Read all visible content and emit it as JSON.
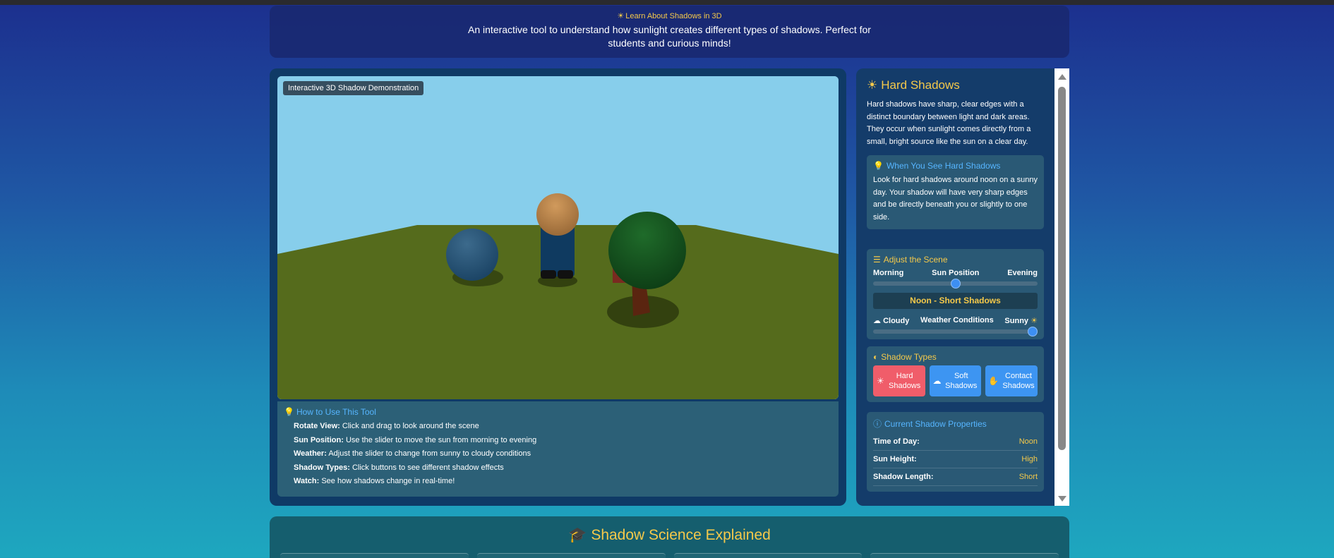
{
  "header": {
    "kicker": "Learn About Shadows in 3D",
    "description": "An interactive tool to understand how sunlight creates different types of shadows. Perfect for students and curious minds!"
  },
  "viewport": {
    "badge": "Interactive 3D Shadow Demonstration"
  },
  "howto": {
    "title": "How to Use This Tool",
    "items": [
      {
        "label": "Rotate View:",
        "text": "Click and drag to look around the scene"
      },
      {
        "label": "Sun Position:",
        "text": "Use the slider to move the sun from morning to evening"
      },
      {
        "label": "Weather:",
        "text": "Adjust the slider to change from sunny to cloudy conditions"
      },
      {
        "label": "Shadow Types:",
        "text": "Click buttons to see different shadow effects"
      },
      {
        "label": "Watch:",
        "text": "See how shadows change in real-time!"
      }
    ]
  },
  "side": {
    "title": "Hard Shadows",
    "description": "Hard shadows have sharp, clear edges with a distinct boundary between light and dark areas. They occur when sunlight comes directly from a small, bright source like the sun on a clear day.",
    "when": {
      "title": "When You See Hard Shadows",
      "text": "Look for hard shadows around noon on a sunny day. Your shadow will have very sharp edges and be directly beneath you or slightly to one side."
    },
    "adjust": {
      "title": "Adjust the Scene",
      "sun_left": "Morning",
      "sun_center": "Sun Position",
      "sun_right": "Evening",
      "sun_value": 0.5,
      "status": "Noon - Short Shadows",
      "wx_left": "Cloudy",
      "wx_center": "Weather Conditions",
      "wx_right": "Sunny",
      "wx_value": 1.0
    },
    "types": {
      "title": "Shadow Types",
      "hard": "Hard Shadows",
      "soft": "Soft Shadows",
      "contact": "Contact Shadows"
    },
    "props": {
      "title": "Current Shadow Properties",
      "rows": [
        {
          "k": "Time of Day:",
          "v": "Noon"
        },
        {
          "k": "Sun Height:",
          "v": "High"
        },
        {
          "k": "Shadow Length:",
          "v": "Short"
        }
      ]
    }
  },
  "science": {
    "title": "Shadow Science Explained"
  },
  "colors": {
    "accent_gold": "#f5c94a",
    "accent_blue": "#56b5ff",
    "hard_button": "#f05d6a",
    "soft_button": "#3d95f2"
  }
}
